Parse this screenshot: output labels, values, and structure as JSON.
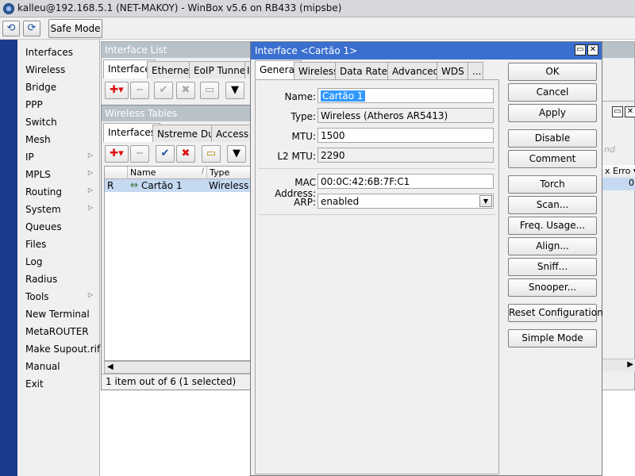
{
  "window": {
    "title": "kalleu@192.168.5.1 (NET-MAKOY) - WinBox v5.6 on RB433 (mipsbe)"
  },
  "toolbar": {
    "safe_mode_label": "Safe Mode"
  },
  "menu": {
    "items": [
      {
        "label": "Interfaces",
        "submenu": false
      },
      {
        "label": "Wireless",
        "submenu": false
      },
      {
        "label": "Bridge",
        "submenu": false
      },
      {
        "label": "PPP",
        "submenu": false
      },
      {
        "label": "Switch",
        "submenu": false
      },
      {
        "label": "Mesh",
        "submenu": false
      },
      {
        "label": "IP",
        "submenu": true
      },
      {
        "label": "MPLS",
        "submenu": true
      },
      {
        "label": "Routing",
        "submenu": true
      },
      {
        "label": "System",
        "submenu": true
      },
      {
        "label": "Queues",
        "submenu": false
      },
      {
        "label": "Files",
        "submenu": false
      },
      {
        "label": "Log",
        "submenu": false
      },
      {
        "label": "Radius",
        "submenu": false
      },
      {
        "label": "Tools",
        "submenu": true
      },
      {
        "label": "New Terminal",
        "submenu": false
      },
      {
        "label": "MetaROUTER",
        "submenu": false
      },
      {
        "label": "Make Supout.rif",
        "submenu": false
      },
      {
        "label": "Manual",
        "submenu": false
      },
      {
        "label": "Exit",
        "submenu": false
      }
    ]
  },
  "interface_list": {
    "title": "Interface List",
    "tabs": [
      "Interface",
      "Ethernet",
      "EoIP Tunnel",
      "I"
    ]
  },
  "right_panel": {
    "col_errors": "x Erro",
    "value": "0",
    "filter_hint": "nd"
  },
  "wireless_tables": {
    "title": "Wireless Tables",
    "tabs": [
      "Interfaces",
      "Nstreme Dual",
      "Access L"
    ],
    "columns": [
      "Name",
      "Type"
    ],
    "rows": [
      {
        "flag": "R",
        "name": "Cartão 1",
        "type": "Wireless (A"
      }
    ],
    "status": "1 item out of 6 (1 selected)"
  },
  "dialog": {
    "title": "Interface <Cartão 1>",
    "tabs": [
      "General",
      "Wireless",
      "Data Rates",
      "Advanced",
      "WDS",
      "..."
    ],
    "fields": {
      "name_label": "Name:",
      "name_value": "Cartão 1",
      "type_label": "Type:",
      "type_value": "Wireless (Atheros AR5413)",
      "mtu_label": "MTU:",
      "mtu_value": "1500",
      "l2mtu_label": "L2 MTU:",
      "l2mtu_value": "2290",
      "mac_label": "MAC Address:",
      "mac_value": "00:0C:42:6B:7F:C1",
      "arp_label": "ARP:",
      "arp_value": "enabled"
    },
    "buttons": {
      "ok": "OK",
      "cancel": "Cancel",
      "apply": "Apply",
      "disable": "Disable",
      "comment": "Comment",
      "torch": "Torch",
      "scan": "Scan...",
      "freq_usage": "Freq. Usage...",
      "align": "Align...",
      "sniff": "Sniff...",
      "snooper": "Snooper...",
      "reset_configuration": "Reset Configuration",
      "simple_mode": "Simple Mode"
    }
  },
  "colors": {
    "menu_band": "#1b3b8c",
    "dialog_title": "#3a6fcf",
    "selection": "#3399ff",
    "row_selected": "#c5d9f1"
  }
}
